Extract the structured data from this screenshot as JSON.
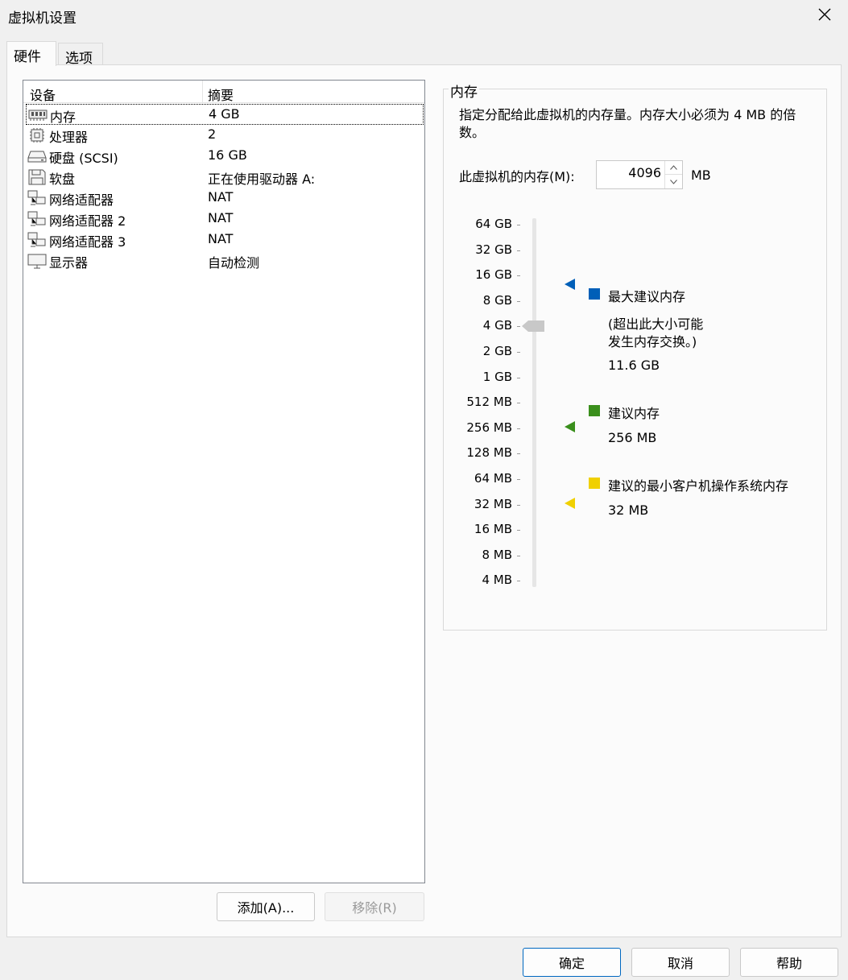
{
  "window": {
    "title": "虚拟机设置"
  },
  "tabs": [
    {
      "label": "硬件"
    },
    {
      "label": "选项"
    }
  ],
  "device_list": {
    "columns": {
      "device": "设备",
      "summary": "摘要"
    },
    "rows": [
      {
        "name": "内存",
        "summary": "4 GB",
        "icon": "memory-icon"
      },
      {
        "name": "处理器",
        "summary": "2",
        "icon": "processor-icon"
      },
      {
        "name": "硬盘 (SCSI)",
        "summary": "16 GB",
        "icon": "harddisk-icon"
      },
      {
        "name": "软盘",
        "summary": "正在使用驱动器 A:",
        "icon": "floppy-icon"
      },
      {
        "name": "网络适配器",
        "summary": "NAT",
        "icon": "network-icon"
      },
      {
        "name": "网络适配器 2",
        "summary": "NAT",
        "icon": "network-icon"
      },
      {
        "name": "网络适配器 3",
        "summary": "NAT",
        "icon": "network-icon"
      },
      {
        "name": "显示器",
        "summary": "自动检测",
        "icon": "display-icon"
      }
    ]
  },
  "list_buttons": {
    "add": "添加(A)...",
    "remove": "移除(R)"
  },
  "memory": {
    "group_title": "内存",
    "description": "指定分配给此虚拟机的内存量。内存大小必须为 4 MB 的倍数。",
    "field_label": "此虚拟机的内存(M):",
    "value": "4096",
    "unit": "MB",
    "scale": [
      "64 GB",
      "32 GB",
      "16 GB",
      "8 GB",
      "4 GB",
      "2 GB",
      "1 GB",
      "512 MB",
      "256 MB",
      "128 MB",
      "64 MB",
      "32 MB",
      "16 MB",
      "8 MB",
      "4 MB"
    ],
    "selected_index": 4,
    "legend": {
      "max": {
        "title": "最大建议内存",
        "note_line1": "(超出此大小可能",
        "note_line2": "发生内存交换。)",
        "value": "11.6 GB",
        "color": "#005fb8"
      },
      "recommended": {
        "title": "建议内存",
        "value": "256 MB",
        "color": "#3a8f1c"
      },
      "min_guest": {
        "title": "建议的最小客户机操作系统内存",
        "value": "32 MB",
        "color": "#f0d000"
      }
    }
  },
  "dialog_buttons": {
    "ok": "确定",
    "cancel": "取消",
    "help": "帮助"
  }
}
